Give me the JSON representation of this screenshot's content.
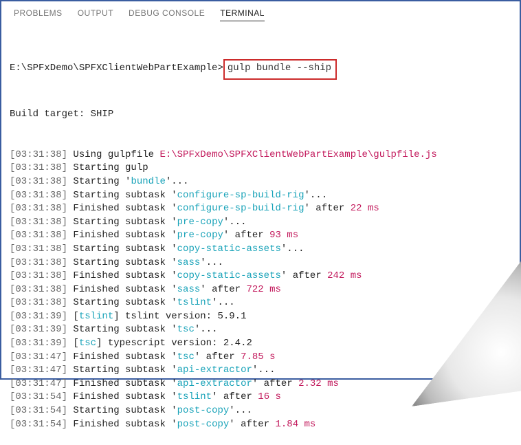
{
  "tabs": {
    "problems": "PROBLEMS",
    "output": "OUTPUT",
    "debug": "DEBUG CONSOLE",
    "terminal": "TERMINAL"
  },
  "prompt": {
    "path": "E:\\SPFxDemo\\SPFXClientWebPartExample>",
    "command": "gulp bundle --ship"
  },
  "buildTargetLine": "Build target: SHIP",
  "lines": [
    {
      "ts": "[03:31:38]",
      "segs": [
        {
          "t": "Using gulpfile ",
          "c": "plain"
        },
        {
          "t": "E:\\SPFxDemo\\SPFXClientWebPartExample\\gulpfile.js",
          "c": "magenta"
        }
      ]
    },
    {
      "ts": "[03:31:38]",
      "segs": [
        {
          "t": "Starting gulp",
          "c": "plain"
        }
      ]
    },
    {
      "ts": "[03:31:38]",
      "segs": [
        {
          "t": "Starting '",
          "c": "plain"
        },
        {
          "t": "bundle",
          "c": "cyan"
        },
        {
          "t": "'...",
          "c": "plain"
        }
      ]
    },
    {
      "ts": "[03:31:38]",
      "segs": [
        {
          "t": "Starting subtask '",
          "c": "plain"
        },
        {
          "t": "configure-sp-build-rig",
          "c": "cyan"
        },
        {
          "t": "'...",
          "c": "plain"
        }
      ]
    },
    {
      "ts": "[03:31:38]",
      "segs": [
        {
          "t": "Finished subtask '",
          "c": "plain"
        },
        {
          "t": "configure-sp-build-rig",
          "c": "cyan"
        },
        {
          "t": "' after ",
          "c": "plain"
        },
        {
          "t": "22 ms",
          "c": "magenta"
        }
      ]
    },
    {
      "ts": "[03:31:38]",
      "segs": [
        {
          "t": "Starting subtask '",
          "c": "plain"
        },
        {
          "t": "pre-copy",
          "c": "cyan"
        },
        {
          "t": "'...",
          "c": "plain"
        }
      ]
    },
    {
      "ts": "[03:31:38]",
      "segs": [
        {
          "t": "Finished subtask '",
          "c": "plain"
        },
        {
          "t": "pre-copy",
          "c": "cyan"
        },
        {
          "t": "' after ",
          "c": "plain"
        },
        {
          "t": "93 ms",
          "c": "magenta"
        }
      ]
    },
    {
      "ts": "[03:31:38]",
      "segs": [
        {
          "t": "Starting subtask '",
          "c": "plain"
        },
        {
          "t": "copy-static-assets",
          "c": "cyan"
        },
        {
          "t": "'...",
          "c": "plain"
        }
      ]
    },
    {
      "ts": "[03:31:38]",
      "segs": [
        {
          "t": "Starting subtask '",
          "c": "plain"
        },
        {
          "t": "sass",
          "c": "cyan"
        },
        {
          "t": "'...",
          "c": "plain"
        }
      ]
    },
    {
      "ts": "[03:31:38]",
      "segs": [
        {
          "t": "Finished subtask '",
          "c": "plain"
        },
        {
          "t": "copy-static-assets",
          "c": "cyan"
        },
        {
          "t": "' after ",
          "c": "plain"
        },
        {
          "t": "242 ms",
          "c": "magenta"
        }
      ]
    },
    {
      "ts": "[03:31:38]",
      "segs": [
        {
          "t": "Finished subtask '",
          "c": "plain"
        },
        {
          "t": "sass",
          "c": "cyan"
        },
        {
          "t": "' after ",
          "c": "plain"
        },
        {
          "t": "722 ms",
          "c": "magenta"
        }
      ]
    },
    {
      "ts": "[03:31:38]",
      "segs": [
        {
          "t": "Starting subtask '",
          "c": "plain"
        },
        {
          "t": "tslint",
          "c": "cyan"
        },
        {
          "t": "'...",
          "c": "plain"
        }
      ]
    },
    {
      "ts": "[03:31:39]",
      "segs": [
        {
          "t": "[",
          "c": "plain"
        },
        {
          "t": "tslint",
          "c": "cyan"
        },
        {
          "t": "] tslint version: 5.9.1",
          "c": "plain"
        }
      ]
    },
    {
      "ts": "[03:31:39]",
      "segs": [
        {
          "t": "Starting subtask '",
          "c": "plain"
        },
        {
          "t": "tsc",
          "c": "cyan"
        },
        {
          "t": "'...",
          "c": "plain"
        }
      ]
    },
    {
      "ts": "[03:31:39]",
      "segs": [
        {
          "t": "[",
          "c": "plain"
        },
        {
          "t": "tsc",
          "c": "cyan"
        },
        {
          "t": "] typescript version: 2.4.2",
          "c": "plain"
        }
      ]
    },
    {
      "ts": "[03:31:47]",
      "segs": [
        {
          "t": "Finished subtask '",
          "c": "plain"
        },
        {
          "t": "tsc",
          "c": "cyan"
        },
        {
          "t": "' after ",
          "c": "plain"
        },
        {
          "t": "7.85 s",
          "c": "magenta"
        }
      ]
    },
    {
      "ts": "[03:31:47]",
      "segs": [
        {
          "t": "Starting subtask '",
          "c": "plain"
        },
        {
          "t": "api-extractor",
          "c": "cyan"
        },
        {
          "t": "'...",
          "c": "plain"
        }
      ]
    },
    {
      "ts": "[03:31:47]",
      "segs": [
        {
          "t": "Finished subtask '",
          "c": "plain"
        },
        {
          "t": "api-extractor",
          "c": "cyan"
        },
        {
          "t": "' after ",
          "c": "plain"
        },
        {
          "t": "2.32 ms",
          "c": "magenta"
        }
      ]
    },
    {
      "ts": "[03:31:54]",
      "segs": [
        {
          "t": "Finished subtask '",
          "c": "plain"
        },
        {
          "t": "tslint",
          "c": "cyan"
        },
        {
          "t": "' after ",
          "c": "plain"
        },
        {
          "t": "16 s",
          "c": "magenta"
        }
      ]
    },
    {
      "ts": "[03:31:54]",
      "segs": [
        {
          "t": "Starting subtask '",
          "c": "plain"
        },
        {
          "t": "post-copy",
          "c": "cyan"
        },
        {
          "t": "'...",
          "c": "plain"
        }
      ]
    },
    {
      "ts": "[03:31:54]",
      "segs": [
        {
          "t": "Finished subtask '",
          "c": "plain"
        },
        {
          "t": "post-copy",
          "c": "cyan"
        },
        {
          "t": "' after ",
          "c": "plain"
        },
        {
          "t": "1.84 ms",
          "c": "magenta"
        }
      ]
    }
  ]
}
